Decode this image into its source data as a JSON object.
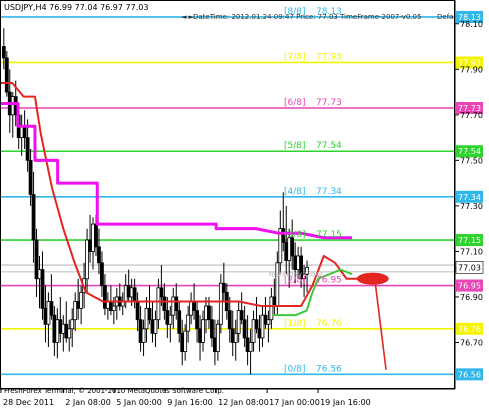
{
  "header": {
    "symbol_ohlc": "USDJPY,H4  76.99 77.04 76.97 77.03",
    "indicator_info": "DateTime: 2012.01.24 09:47   Price: 77.03   TimeFrame-2007-v0.05",
    "default_text": "Defa",
    "scroll_arrows": "◄ ►"
  },
  "footer": {
    "copyright": "FreshForex Terminal, © 2001-2010 MetaQuotes Software Corp."
  },
  "colors": {
    "background": "#ffffff",
    "candles": "#000000",
    "level_blue": "#31b7ea",
    "level_yellow": "#f4f400",
    "level_magenta": "#e845b5",
    "level_green": "#2ed42e",
    "red_line": "#e5251f",
    "magenta_line": "#f00ff0",
    "green_line": "#3cc93c"
  },
  "chart_data": {
    "type": "candlestick",
    "symbol": "USDJPY",
    "timeframe": "H4",
    "ylim": [
      76.5,
      78.2
    ],
    "xlim": [
      0,
      160
    ],
    "price_ticks": [
      {
        "label": "78.10",
        "value": 78.1
      },
      {
        "label": "77.90",
        "value": 77.9
      },
      {
        "label": "77.70",
        "value": 77.7
      },
      {
        "label": "77.50",
        "value": 77.5
      },
      {
        "label": "77.30",
        "value": 77.3
      },
      {
        "label": "77.10",
        "value": 77.1
      },
      {
        "label": "76.90",
        "value": 76.9
      },
      {
        "label": "76.70",
        "value": 76.7
      }
    ],
    "time_ticks": [
      {
        "label": "28 Dec 2011",
        "bar": 0
      },
      {
        "label": "2 Jan 08:00",
        "bar": 22
      },
      {
        "label": "5 Jan 00:00",
        "bar": 40
      },
      {
        "label": "9 Jan 16:00",
        "bar": 58
      },
      {
        "label": "12 Jan 08:00",
        "bar": 76
      },
      {
        "label": "17 Jan 00:00",
        "bar": 94
      },
      {
        "label": "19 Jan 16:00",
        "bar": 112
      }
    ],
    "murrey_levels": [
      {
        "label": "[8/8]",
        "value": 78.13,
        "value_text": "78.13",
        "axis_label": "78.13",
        "color": "#31b7ea"
      },
      {
        "label": "[7/8]",
        "value": 77.93,
        "value_text": "77.93",
        "axis_label": "77.93",
        "color": "#f4f400"
      },
      {
        "label": "[6/8]",
        "value": 77.73,
        "value_text": "77.73",
        "axis_label": "77.73",
        "color": "#e845b5"
      },
      {
        "label": "[5/8]",
        "value": 77.54,
        "value_text": "77.54",
        "axis_label": "77.54",
        "color": "#2ed42e"
      },
      {
        "label": "[4/8]",
        "value": 77.34,
        "value_text": "77.34",
        "axis_label": "77.34",
        "color": "#31b7ea"
      },
      {
        "label": "[3/8]",
        "value": 77.15,
        "value_text": "77.15",
        "axis_label": "77.15",
        "color": "#2ed42e"
      },
      {
        "label": "[2/8]",
        "value": 76.95,
        "value_text": "76.95",
        "axis_label": "76.95",
        "color": "#e845b5"
      },
      {
        "label": "[1/8]",
        "value": 76.76,
        "value_text": "76.76",
        "axis_label": "76.76",
        "color": "#f4f400"
      },
      {
        "label": "[0/8]",
        "value": 76.56,
        "value_text": "76.56",
        "axis_label": "76.56",
        "color": "#31b7ea"
      }
    ],
    "current_price": {
      "label": "77.03",
      "value": 77.03
    },
    "yesterday_close_text": "Yesterday Close",
    "gray_lines": [
      77.04,
      77.01
    ],
    "red_line": {
      "name": "",
      "x": [
        0,
        4,
        8,
        12,
        14,
        18,
        22,
        26,
        30,
        36,
        44,
        52,
        60,
        68,
        76,
        84,
        92,
        100,
        106,
        110,
        114,
        118,
        122,
        126,
        132
      ],
      "y": [
        77.84,
        77.84,
        77.78,
        77.78,
        77.62,
        77.38,
        77.2,
        77.05,
        76.92,
        76.88,
        76.88,
        76.88,
        76.88,
        76.88,
        76.88,
        76.88,
        76.86,
        76.86,
        76.86,
        76.95,
        77.08,
        77.05,
        76.98,
        76.98,
        76.98
      ]
    },
    "red_projection": {
      "x": [
        132,
        136
      ],
      "y": [
        76.98,
        76.58
      ]
    },
    "magenta_line": {
      "name": "",
      "x": [
        0,
        6,
        6,
        12,
        12,
        20,
        20,
        34,
        34,
        36,
        48,
        76,
        76,
        90,
        98,
        106,
        114,
        124
      ],
      "y": [
        77.75,
        77.75,
        77.65,
        77.65,
        77.5,
        77.5,
        77.4,
        77.4,
        77.22,
        77.22,
        77.22,
        77.22,
        77.2,
        77.2,
        77.18,
        77.18,
        77.16,
        77.16
      ]
    },
    "green_line": {
      "name": "",
      "x": [
        96,
        100,
        104,
        108,
        110,
        112,
        116,
        120,
        124
      ],
      "y": [
        76.82,
        76.82,
        76.82,
        76.84,
        76.92,
        76.98,
        77.0,
        77.02,
        77.0
      ]
    },
    "candles": [
      {
        "o": 78.0,
        "h": 78.08,
        "l": 77.9,
        "c": 77.95
      },
      {
        "o": 77.95,
        "h": 77.98,
        "l": 77.78,
        "c": 77.8
      },
      {
        "o": 77.8,
        "h": 77.9,
        "l": 77.62,
        "c": 77.7
      },
      {
        "o": 77.7,
        "h": 77.8,
        "l": 77.6,
        "c": 77.78
      },
      {
        "o": 77.78,
        "h": 77.85,
        "l": 77.65,
        "c": 77.7
      },
      {
        "o": 77.7,
        "h": 77.75,
        "l": 77.55,
        "c": 77.6
      },
      {
        "o": 77.6,
        "h": 77.7,
        "l": 77.52,
        "c": 77.65
      },
      {
        "o": 77.65,
        "h": 77.72,
        "l": 77.55,
        "c": 77.6
      },
      {
        "o": 77.6,
        "h": 77.68,
        "l": 77.45,
        "c": 77.5
      },
      {
        "o": 77.5,
        "h": 77.55,
        "l": 77.3,
        "c": 77.35
      },
      {
        "o": 77.35,
        "h": 77.45,
        "l": 77.05,
        "c": 77.15
      },
      {
        "o": 77.15,
        "h": 77.2,
        "l": 76.9,
        "c": 76.98
      },
      {
        "o": 76.98,
        "h": 77.08,
        "l": 76.85,
        "c": 77.02
      },
      {
        "o": 77.02,
        "h": 77.1,
        "l": 76.8,
        "c": 76.85
      },
      {
        "o": 76.85,
        "h": 76.95,
        "l": 76.7,
        "c": 76.78
      },
      {
        "o": 76.78,
        "h": 76.92,
        "l": 76.68,
        "c": 76.88
      },
      {
        "o": 76.88,
        "h": 77.0,
        "l": 76.8,
        "c": 76.82
      },
      {
        "o": 76.82,
        "h": 76.86,
        "l": 76.64,
        "c": 76.7
      },
      {
        "o": 76.7,
        "h": 76.85,
        "l": 76.63,
        "c": 76.8
      },
      {
        "o": 76.8,
        "h": 76.9,
        "l": 76.7,
        "c": 76.74
      },
      {
        "o": 76.74,
        "h": 76.82,
        "l": 76.66,
        "c": 76.78
      },
      {
        "o": 76.78,
        "h": 76.88,
        "l": 76.7,
        "c": 76.72
      },
      {
        "o": 76.72,
        "h": 76.8,
        "l": 76.66,
        "c": 76.76
      },
      {
        "o": 76.76,
        "h": 76.85,
        "l": 76.68,
        "c": 76.8
      },
      {
        "o": 76.8,
        "h": 76.92,
        "l": 76.75,
        "c": 76.88
      },
      {
        "o": 76.88,
        "h": 76.98,
        "l": 76.8,
        "c": 76.85
      },
      {
        "o": 76.85,
        "h": 76.95,
        "l": 76.78,
        "c": 76.92
      },
      {
        "o": 76.92,
        "h": 77.05,
        "l": 76.85,
        "c": 76.98
      },
      {
        "o": 76.98,
        "h": 77.2,
        "l": 76.92,
        "c": 77.15
      },
      {
        "o": 77.15,
        "h": 77.26,
        "l": 77.05,
        "c": 77.1
      },
      {
        "o": 77.1,
        "h": 77.25,
        "l": 77.02,
        "c": 77.22
      },
      {
        "o": 77.22,
        "h": 77.26,
        "l": 77.08,
        "c": 77.12
      },
      {
        "o": 77.12,
        "h": 77.2,
        "l": 77.0,
        "c": 77.05
      },
      {
        "o": 77.05,
        "h": 77.1,
        "l": 76.9,
        "c": 76.95
      },
      {
        "o": 76.95,
        "h": 77.0,
        "l": 76.82,
        "c": 76.85
      },
      {
        "o": 76.85,
        "h": 76.92,
        "l": 76.8,
        "c": 76.88
      },
      {
        "o": 76.88,
        "h": 76.95,
        "l": 76.82,
        "c": 76.84
      },
      {
        "o": 76.84,
        "h": 76.9,
        "l": 76.78,
        "c": 76.86
      },
      {
        "o": 76.86,
        "h": 76.94,
        "l": 76.8,
        "c": 76.9
      },
      {
        "o": 76.9,
        "h": 76.96,
        "l": 76.84,
        "c": 76.86
      },
      {
        "o": 76.86,
        "h": 76.92,
        "l": 76.82,
        "c": 76.88
      },
      {
        "o": 76.88,
        "h": 77.0,
        "l": 76.85,
        "c": 76.95
      },
      {
        "o": 76.95,
        "h": 77.02,
        "l": 76.88,
        "c": 76.9
      },
      {
        "o": 76.9,
        "h": 76.98,
        "l": 76.86,
        "c": 76.94
      },
      {
        "o": 76.94,
        "h": 76.98,
        "l": 76.85,
        "c": 76.88
      },
      {
        "o": 76.88,
        "h": 76.92,
        "l": 76.75,
        "c": 76.8
      },
      {
        "o": 76.8,
        "h": 76.86,
        "l": 76.66,
        "c": 76.7
      },
      {
        "o": 76.7,
        "h": 76.8,
        "l": 76.64,
        "c": 76.76
      },
      {
        "o": 76.76,
        "h": 76.9,
        "l": 76.7,
        "c": 76.85
      },
      {
        "o": 76.85,
        "h": 76.95,
        "l": 76.78,
        "c": 76.8
      },
      {
        "o": 76.8,
        "h": 76.88,
        "l": 76.7,
        "c": 76.74
      },
      {
        "o": 76.74,
        "h": 76.84,
        "l": 76.68,
        "c": 76.8
      },
      {
        "o": 76.8,
        "h": 76.98,
        "l": 76.76,
        "c": 76.94
      },
      {
        "o": 76.94,
        "h": 77.04,
        "l": 76.86,
        "c": 76.9
      },
      {
        "o": 76.9,
        "h": 76.96,
        "l": 76.8,
        "c": 76.84
      },
      {
        "o": 76.84,
        "h": 76.9,
        "l": 76.72,
        "c": 76.78
      },
      {
        "o": 76.78,
        "h": 76.86,
        "l": 76.7,
        "c": 76.82
      },
      {
        "o": 76.82,
        "h": 76.94,
        "l": 76.76,
        "c": 76.9
      },
      {
        "o": 76.9,
        "h": 76.96,
        "l": 76.8,
        "c": 76.84
      },
      {
        "o": 76.84,
        "h": 76.88,
        "l": 76.7,
        "c": 76.74
      },
      {
        "o": 76.74,
        "h": 76.8,
        "l": 76.6,
        "c": 76.66
      },
      {
        "o": 76.66,
        "h": 76.78,
        "l": 76.62,
        "c": 76.75
      },
      {
        "o": 76.75,
        "h": 76.86,
        "l": 76.7,
        "c": 76.82
      },
      {
        "o": 76.82,
        "h": 76.92,
        "l": 76.78,
        "c": 76.88
      },
      {
        "o": 76.88,
        "h": 76.96,
        "l": 76.8,
        "c": 76.84
      },
      {
        "o": 76.84,
        "h": 76.88,
        "l": 76.7,
        "c": 76.76
      },
      {
        "o": 76.76,
        "h": 76.82,
        "l": 76.62,
        "c": 76.7
      },
      {
        "o": 76.7,
        "h": 76.84,
        "l": 76.66,
        "c": 76.8
      },
      {
        "o": 76.8,
        "h": 76.9,
        "l": 76.74,
        "c": 76.86
      },
      {
        "o": 76.86,
        "h": 76.9,
        "l": 76.76,
        "c": 76.8
      },
      {
        "o": 76.8,
        "h": 76.86,
        "l": 76.68,
        "c": 76.72
      },
      {
        "o": 76.72,
        "h": 76.8,
        "l": 76.6,
        "c": 76.66
      },
      {
        "o": 76.66,
        "h": 76.8,
        "l": 76.62,
        "c": 76.78
      },
      {
        "o": 76.78,
        "h": 77.0,
        "l": 76.74,
        "c": 76.96
      },
      {
        "o": 76.96,
        "h": 77.05,
        "l": 76.88,
        "c": 76.92
      },
      {
        "o": 76.92,
        "h": 76.96,
        "l": 76.8,
        "c": 76.84
      },
      {
        "o": 76.84,
        "h": 76.9,
        "l": 76.7,
        "c": 76.76
      },
      {
        "o": 76.76,
        "h": 76.84,
        "l": 76.64,
        "c": 76.7
      },
      {
        "o": 76.7,
        "h": 76.8,
        "l": 76.62,
        "c": 76.74
      },
      {
        "o": 76.74,
        "h": 76.88,
        "l": 76.7,
        "c": 76.84
      },
      {
        "o": 76.84,
        "h": 76.92,
        "l": 76.78,
        "c": 76.8
      },
      {
        "o": 76.8,
        "h": 76.86,
        "l": 76.68,
        "c": 76.72
      },
      {
        "o": 76.72,
        "h": 76.82,
        "l": 76.6,
        "c": 76.66
      },
      {
        "o": 76.66,
        "h": 76.76,
        "l": 76.56,
        "c": 76.7
      },
      {
        "o": 76.7,
        "h": 76.84,
        "l": 76.66,
        "c": 76.8
      },
      {
        "o": 76.8,
        "h": 76.9,
        "l": 76.74,
        "c": 76.76
      },
      {
        "o": 76.76,
        "h": 76.82,
        "l": 76.66,
        "c": 76.72
      },
      {
        "o": 76.72,
        "h": 76.86,
        "l": 76.68,
        "c": 76.82
      },
      {
        "o": 76.82,
        "h": 76.9,
        "l": 76.76,
        "c": 76.78
      },
      {
        "o": 76.78,
        "h": 76.84,
        "l": 76.7,
        "c": 76.8
      },
      {
        "o": 76.8,
        "h": 76.94,
        "l": 76.76,
        "c": 76.9
      },
      {
        "o": 76.9,
        "h": 76.98,
        "l": 76.82,
        "c": 76.86
      },
      {
        "o": 76.86,
        "h": 77.1,
        "l": 76.82,
        "c": 77.05
      },
      {
        "o": 77.05,
        "h": 77.28,
        "l": 77.0,
        "c": 77.2
      },
      {
        "o": 77.2,
        "h": 77.36,
        "l": 77.1,
        "c": 77.14
      },
      {
        "o": 77.14,
        "h": 77.3,
        "l": 77.0,
        "c": 77.06
      },
      {
        "o": 77.06,
        "h": 77.2,
        "l": 76.94,
        "c": 77.16
      },
      {
        "o": 77.16,
        "h": 77.24,
        "l": 77.02,
        "c": 77.08
      },
      {
        "o": 77.08,
        "h": 77.14,
        "l": 76.96,
        "c": 77.02
      },
      {
        "o": 77.02,
        "h": 77.12,
        "l": 76.98,
        "c": 77.08
      },
      {
        "o": 77.08,
        "h": 77.12,
        "l": 76.94,
        "c": 76.98
      },
      {
        "o": 76.98,
        "h": 77.04,
        "l": 76.9,
        "c": 77.0
      },
      {
        "o": 77.0,
        "h": 77.06,
        "l": 76.92,
        "c": 77.03
      }
    ]
  }
}
